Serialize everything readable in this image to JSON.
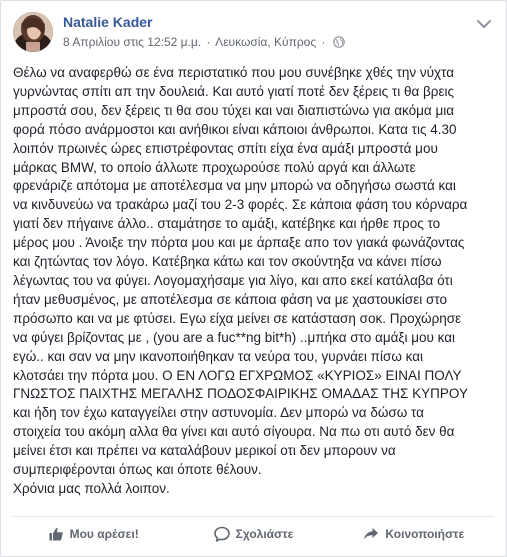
{
  "post": {
    "author_name": "Natalie Kader",
    "timestamp": "8 Απριλίου στις 12:52 μ.μ.",
    "separator": "·",
    "location": "Λευκωσία, Κύπρος",
    "privacy_icon": "globe-icon",
    "options_icon": "chevron-down-icon",
    "body": "Θέλω να αναφερθώ σε ένα περιστατικό που μου συνέβηκε χθές την νύχτα\nγυρνώντας σπίτι απ την δουλειά. Και αυτό γιατί ποτέ δεν ξέρεις τι θα βρεις\nμπροστά σου, δεν ξέρεις τι θα σου τύχει και ναι διαπιστώνω για ακόμα μια\nφορά πόσο ανάρμοστοι και ανήθικοι είναι κάποιοι άνθρωποι. Κατα τις 4.30\nλοιπόν πρωινές ώρες επιστρέφοντας σπίτι είχα ένα αμάξι μπροστά μου\nμάρκας BMW, το οποίο άλλωτε προχωρούσε πολύ αργά και άλλωτε\nφρενάριζε απότομα με αποτέλεσμα να μην μπορώ να οδηγήσω σωστά και\nνα κινδυνεύω να τρακάρω μαζί του 2-3 φορές. Σε κάποια φάση του κόρναρα\nγιατί δεν πήγαινε άλλο.. σταμάτησε το αμάξι, κατέβηκε και ήρθε προς το\nμέρος μου . Άνοιξε την πόρτα μου και με άρπαξε απο τον γιακά φωνάζοντας\nκαι ζητώντας τον λόγο. Κατέβηκα κάτω και τον σκούντηξα να κάνει πίσω\nλέγωντας του να φύγει. Λογομαχήσαμε για λίγο, και απο εκεί κατάλαβα ότι\nήταν μεθυσμένος, με αποτέλεσμα σε κάποια φάση να με χαστουκίσει στο\nπρόσωπο και να με φτύσει. Εγω είχα μείνει σε κατάσταση σοκ. Προχώρησε\nνα φύγει βρίζοντας με , (you are a fuc**ng bit*h) ..μπήκα στο αμάξι μου και\nεγώ.. και σαν να μην ικανοποιήθηκαν τα νεύρα του, γυρνάει πίσω και\nκλοτσάει την πόρτα μου. Ο ΕΝ ΛΟΓΩ ΕΓΧΡΩΜΟΣ «ΚΥΡΙΟΣ» ΕΙΝΑΙ ΠΟΛΥ\nΓΝΩΣΤΟΣ ΠΑΙΧΤΗΣ ΜΕΓΑΛΗΣ ΠΟΔΟΣΦΑΙΡΙΚΗΣ ΟΜΑΔΑΣ ΤΗΣ ΚΥΠΡΟΥ\nκαι ήδη τον έχω καταγγείλει στην αστυνομία. Δεν μπορώ να δώσω τα\nστοιχεία του ακόμη αλλα θα γίνει και αυτό σίγουρα. Να πω οτι αυτό δεν θα\nμείνει έτσι και πρέπει να καταλάβουν μερικοί οτι δεν μπορουν να\nσυμπεριφέρονται όπως και όποτε θέλουν.\nΧρόνια μας πολλά λοιπον."
  },
  "actions": [
    {
      "label": "Μου αρέσει!",
      "icon": "thumbs-up-icon"
    },
    {
      "label": "Σχολιάστε",
      "icon": "comment-icon"
    },
    {
      "label": "Κοινοποιήστε",
      "icon": "share-icon"
    }
  ],
  "colors": {
    "author_link": "#365899",
    "meta_text": "#616770",
    "body_text": "#1d2129",
    "action_text": "#606770",
    "page_background": "#e9ebee"
  }
}
